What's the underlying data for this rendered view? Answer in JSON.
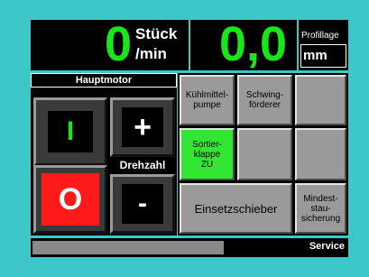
{
  "display": {
    "count_value": "0",
    "count_unit_line1": "Stück",
    "count_unit_line2": "/min",
    "speed_value": "0,0",
    "profillage_label": "Profillage",
    "unit_mm": "mm"
  },
  "hauptmotor": {
    "title": "Hauptmotor",
    "on_label": "I",
    "off_label": "O",
    "plus_label": "+",
    "minus_label": "-",
    "drehzahl_label": "Drehzahl"
  },
  "grid": {
    "kuehlmittelpumpe": "Kühlmittel-\npumpe",
    "schwingfoerderer": "Schwing-\nförderer",
    "sortierklappe": "Sortier-\nklappe\nZU",
    "einsetzschieber": "Einsetzschieber",
    "mindeststausicherung": "Mindest-\nstau-\nsicherung"
  },
  "status_bar": {
    "service_label": "Service"
  },
  "colors": {
    "background": "#3ec7c9",
    "green_text": "#19e619",
    "sortier_active": "#33e633",
    "off_red": "#ff1a1a"
  }
}
